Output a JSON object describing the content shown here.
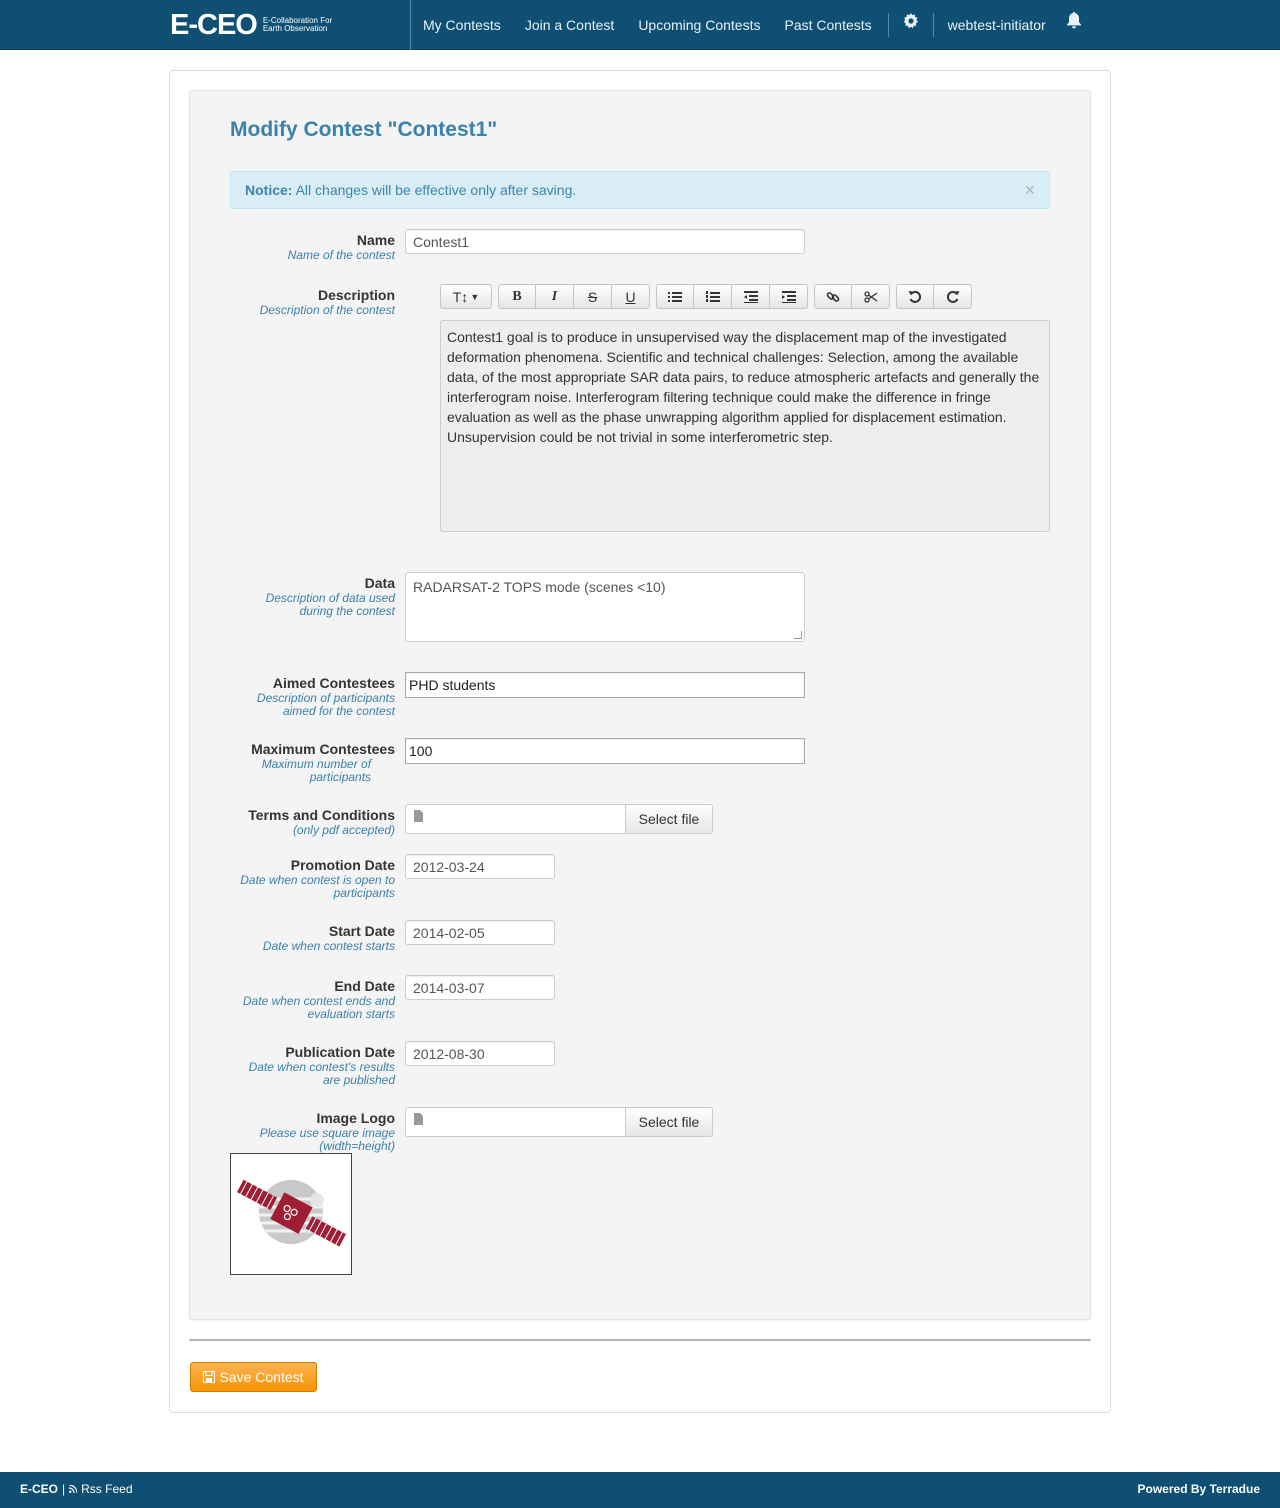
{
  "brand": {
    "logo": "E-CEO",
    "subtitle": "E-Collaboration For Earth Observation"
  },
  "nav": {
    "items": [
      "My Contests",
      "Join a Contest",
      "Upcoming Contests",
      "Past Contests"
    ],
    "settings_icon": "gear-icon",
    "user": "webtest-initiator",
    "notification_icon": "bell-icon"
  },
  "page": {
    "title": "Modify Contest \"Contest1\"",
    "notice": {
      "label": "Notice:",
      "text": "All changes will be effective only after saving.",
      "close": "×"
    }
  },
  "form": {
    "name": {
      "label": "Name",
      "help": "Name of the contest",
      "value": "Contest1"
    },
    "description": {
      "label": "Description",
      "help": "Description of the contest",
      "value": "Contest1 goal is to produce in unsupervised way the displacement map of the investigated deformation phenomena. Scientific and technical challenges: Selection, among the available data, of the most appropriate SAR data pairs, to reduce atmospheric artefacts and generally the interferogram noise. Interferogram filtering technique could make the difference in fringe evaluation as well as the phase unwrapping algorithm applied for displacement estimation. Unsupervision could be not trivial in some interferometric step.",
      "toolbar": {
        "font": "T↕",
        "bold": "B",
        "italic": "I",
        "strike": "S",
        "underline": "U",
        "unordered_list": "≣",
        "ordered_list": "≣",
        "outdent": "≣",
        "indent": "≣",
        "link": "⚭",
        "unlink": "✂",
        "undo": "↺",
        "redo": "↻"
      }
    },
    "data": {
      "label": "Data",
      "help": "Description of data used during the contest",
      "value": "RADARSAT-2 TOPS mode (scenes <10)"
    },
    "aimed": {
      "label": "Aimed Contestees",
      "help": "Description of participants aimed for the contest",
      "value": "PHD students"
    },
    "maximum": {
      "label": "Maximum Contestees",
      "help": "Maximum number of participants",
      "value": "100"
    },
    "terms": {
      "label": "Terms and Conditions",
      "help": "(only pdf accepted)",
      "button": "Select file"
    },
    "promotion": {
      "label": "Promotion Date",
      "help": "Date when contest is open to participants",
      "value": "2012-03-24"
    },
    "start": {
      "label": "Start Date",
      "help": "Date when contest starts",
      "value": "2014-02-05"
    },
    "end": {
      "label": "End Date",
      "help": "Date when contest ends and evaluation starts",
      "value": "2014-03-07"
    },
    "publication": {
      "label": "Publication Date",
      "help": "Date when contest's results are published",
      "value": "2012-08-30"
    },
    "logo": {
      "label": "Image Logo",
      "help": "Please use square image (width=height)",
      "button": "Select file"
    }
  },
  "save_button": "Save Contest",
  "footer": {
    "brand": "E-CEO",
    "sep": "|",
    "rss": "Rss Feed",
    "powered": "Powered By Terradue"
  },
  "colors": {
    "navbar": "#0e4f73",
    "title": "#3a81ab",
    "save": "#f89406"
  }
}
